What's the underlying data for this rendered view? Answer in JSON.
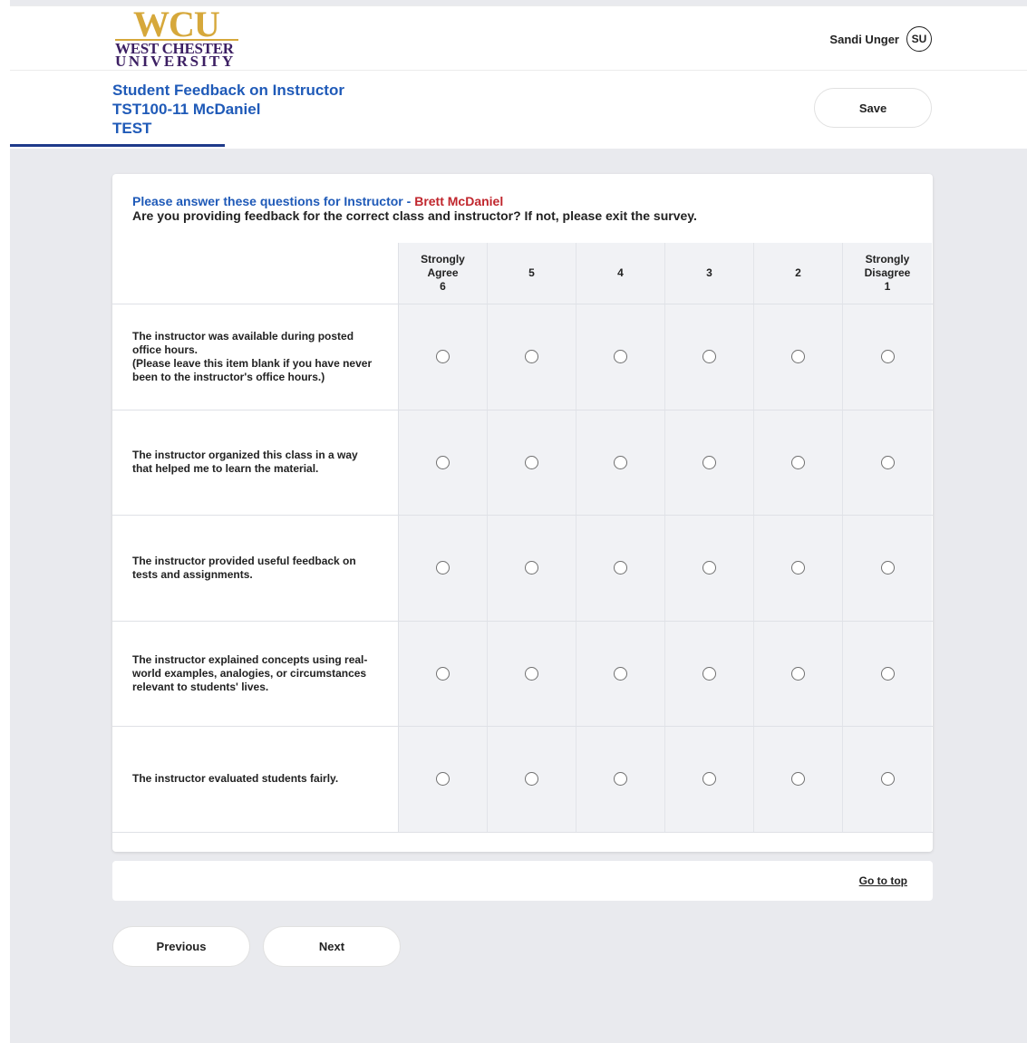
{
  "logo": {
    "mark": "WCU",
    "line1": "WEST CHESTER",
    "line2": "UNIVERSITY"
  },
  "user": {
    "name": "Sandi Unger",
    "initials": "SU"
  },
  "survey": {
    "title_lines": [
      "Student Feedback on Instructor",
      "TST100-11 McDaniel",
      "TEST"
    ],
    "save_label": "Save"
  },
  "instructions": {
    "prefix": "Please answer these questions for Instructor - ",
    "instructor": "Brett McDaniel",
    "question": "Are you providing feedback for the correct class and instructor? If not, please exit the survey."
  },
  "scale": {
    "columns": [
      "Strongly\nAgree\n6",
      "5",
      "4",
      "3",
      "2",
      "Strongly\nDisagree\n1"
    ]
  },
  "questions": [
    {
      "text": "The instructor was available during posted office hours.\n (Please leave this item blank if you have never been to the instructor's office hours.)"
    },
    {
      "text": "The instructor organized this class in a way that helped me to learn the material."
    },
    {
      "text": "The instructor provided useful feedback on tests and assignments."
    },
    {
      "text": "The instructor explained concepts using real-world examples, analogies, or circumstances relevant to students' lives."
    },
    {
      "text": "The instructor evaluated students fairly."
    }
  ],
  "footer": {
    "go_to_top": "Go to top",
    "previous": "Previous",
    "next": "Next"
  },
  "colors": {
    "title_blue": "#1f5ab8",
    "instructor_red": "#c0262d",
    "logo_gold": "#d6a83b",
    "logo_purple": "#3c1f63",
    "background": "#e9eaee"
  }
}
